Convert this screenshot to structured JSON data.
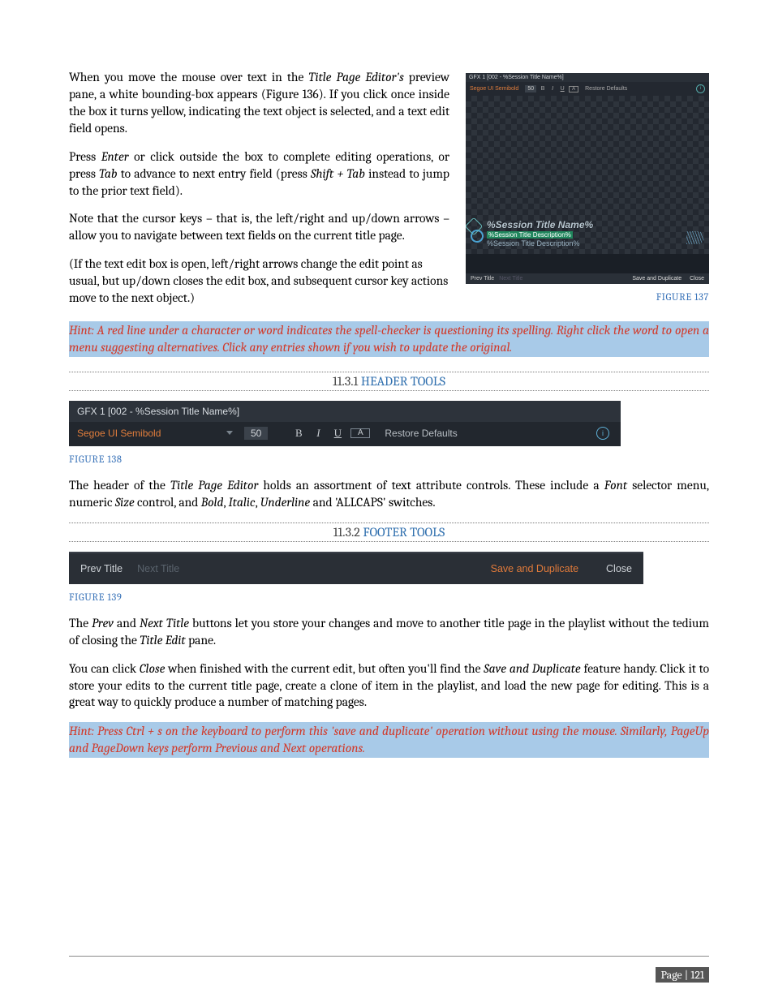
{
  "figure137": {
    "titlebar": "GFX 1  [002 - %Session Title Name%]",
    "font": "Segoe UI Semibold",
    "size": "50",
    "buttons": {
      "bold": "B",
      "italic": "I",
      "underline": "U",
      "allcaps": "A"
    },
    "restore": "Restore Defaults",
    "preview": {
      "line1": "%Session Title Name%",
      "line2": "%Session Title Description%",
      "line3": "%Session Title Description%"
    },
    "footer": {
      "prev": "Prev Title",
      "next": "Next Title",
      "save_dup": "Save and Duplicate",
      "close": "Close"
    },
    "caption": "FIGURE 137"
  },
  "para1": {
    "a": "When you move the mouse over text in the ",
    "b": "Title Page Editor's",
    "c": " preview pane, a white bounding-box appears (Figure 136). If you click once inside the box it turns yellow, indicating the text object is selected, and a text edit field opens."
  },
  "para2": {
    "a": "Press ",
    "b": "Enter",
    "c": " or click outside the box to complete editing operations, or press ",
    "d": "Tab",
    "e": " to advance to next entry field (press ",
    "f": "Shift + Tab",
    "g": " instead to jump to the prior text field)."
  },
  "para3": "Note that the cursor keys – that is, the left/right and up/down arrows – allow you to navigate between text fields on the current title page.",
  "para4": "(If the text edit box is open, left/right arrows change the edit point as usual, but up/down closes the edit box, and subsequent cursor key actions move to the next object.)",
  "hint1": "Hint: A red line under a character or word indicates the spell-checker is questioning its spelling.  Right click the word to open a menu suggesting alternatives.  Click any entries shown if you wish to update the original.",
  "section1": {
    "num": "11.3.1 ",
    "title": "HEADER TOOLS"
  },
  "figure138": {
    "row1": "GFX 1  [002 - %Session Title Name%]",
    "font": "Segoe UI Semibold",
    "size": "50",
    "bold": "B",
    "italic": "I",
    "underline": "U",
    "allcaps": "A",
    "restore": "Restore Defaults",
    "caption": "FIGURE 138"
  },
  "para5": {
    "a": "The header of the ",
    "b": "Title Page Editor",
    "c": " holds an assortment of text attribute controls.  These include a ",
    "d": "Font",
    "e": " selector menu, numeric ",
    "f": "Size",
    "g": " control, and ",
    "h": "Bold",
    "i": ", ",
    "j": "Italic",
    "k": ", ",
    "l": "Underline",
    "m": " and 'ALLCAPS' switches."
  },
  "section2": {
    "num": "11.3.2 ",
    "title": "FOOTER TOOLS"
  },
  "figure139": {
    "prev": "Prev Title",
    "next": "Next Title",
    "save_dup": "Save and Duplicate",
    "close": "Close",
    "caption": "FIGURE 139"
  },
  "para6": {
    "a": "The ",
    "b": "Prev",
    "c": " and ",
    "d": "Next Title",
    "e": " buttons let you store your changes and move to another title page in the playlist without the tedium of closing the ",
    "f": "Title Edit",
    "g": " pane."
  },
  "para7": {
    "a": "You can click ",
    "b": "Close",
    "c": " when finished with the current edit, but often you'll find the ",
    "d": "Save and Duplicate",
    "e": " feature handy.  Click it to store your edits to the current title page, create a clone of item in the playlist, and load the new page for editing.  This is a great way to quickly produce a number of matching pages."
  },
  "hint2": "Hint: Press Ctrl + s on the keyboard to perform this 'save and duplicate' operation without using the mouse.  Similarly, PageUp and PageDown keys perform Previous and Next operations.",
  "page_number": "Page | 121"
}
